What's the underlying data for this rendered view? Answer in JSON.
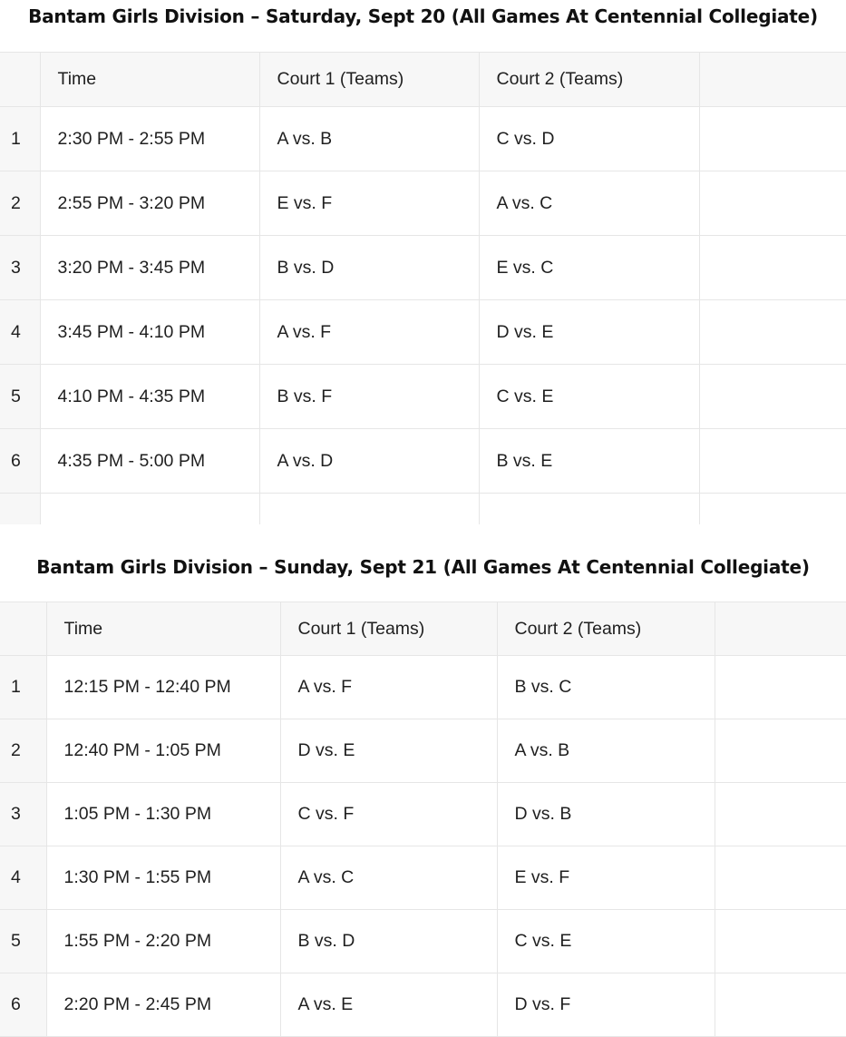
{
  "saturday": {
    "title": "Bantam Girls Division – Saturday, Sept 20 (All Games At Centennial Collegiate)",
    "headers": {
      "num": "",
      "time": "Time",
      "court1": "Court 1 (Teams)",
      "court2": "Court 2 (Teams)",
      "extra": ""
    },
    "rows": [
      {
        "num": "1",
        "time": "2:30 PM - 2:55 PM",
        "court1": "A vs. B",
        "court2": "C vs. D"
      },
      {
        "num": "2",
        "time": "2:55 PM - 3:20 PM",
        "court1": "E vs. F",
        "court2": "A vs. C"
      },
      {
        "num": "3",
        "time": "3:20 PM - 3:45 PM",
        "court1": "B vs. D",
        "court2": "E vs. C"
      },
      {
        "num": "4",
        "time": "3:45 PM - 4:10 PM",
        "court1": "A vs. F",
        "court2": "D vs. E"
      },
      {
        "num": "5",
        "time": "4:10 PM - 4:35 PM",
        "court1": "B vs. F",
        "court2": "C vs. E"
      },
      {
        "num": "6",
        "time": "4:35 PM - 5:00 PM",
        "court1": "A vs. D",
        "court2": "B vs. E"
      }
    ]
  },
  "sunday": {
    "title": "Bantam Girls Division – Sunday, Sept 21 (All Games At Centennial Collegiate)",
    "headers": {
      "num": "",
      "time": "Time",
      "court1": "Court 1 (Teams)",
      "court2": "Court 2 (Teams)",
      "extra": ""
    },
    "rows": [
      {
        "num": "1",
        "time": "12:15 PM - 12:40 PM",
        "court1": "A vs. F",
        "court2": "B vs. C"
      },
      {
        "num": "2",
        "time": "12:40 PM - 1:05 PM",
        "court1": "D vs. E",
        "court2": "A vs. B"
      },
      {
        "num": "3",
        "time": "1:05 PM - 1:30 PM",
        "court1": "C vs. F",
        "court2": "D vs. B"
      },
      {
        "num": "4",
        "time": "1:30 PM - 1:55 PM",
        "court1": "A vs. C",
        "court2": "E vs. F"
      },
      {
        "num": "5",
        "time": "1:55 PM - 2:20 PM",
        "court1": "B vs. D",
        "court2": "C vs. E"
      },
      {
        "num": "6",
        "time": "2:20 PM - 2:45 PM",
        "court1": "A vs. E",
        "court2": "D vs. F"
      }
    ]
  }
}
